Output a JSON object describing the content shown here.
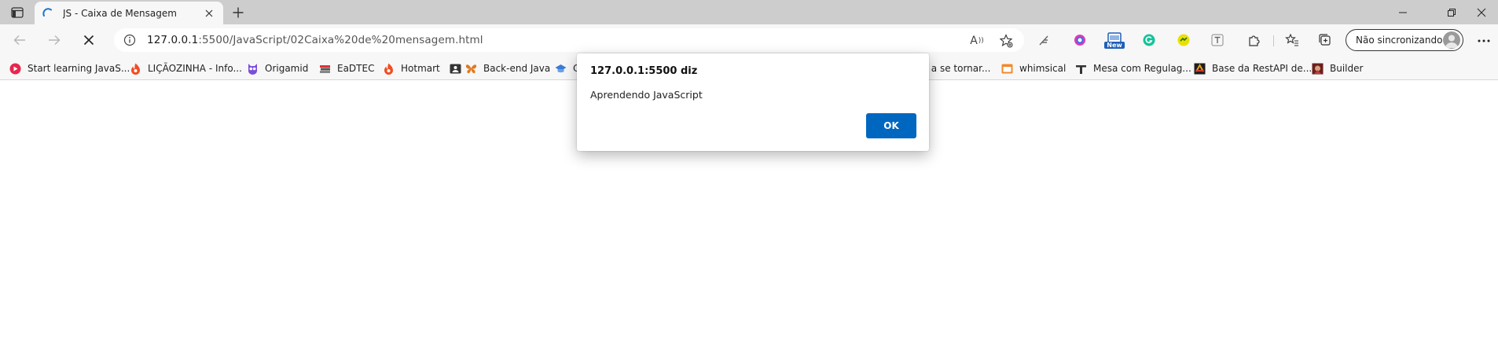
{
  "tab": {
    "title": "JS - Caixa de Mensagem"
  },
  "address_bar": {
    "host": "127.0.0.1",
    "rest": ":5500/JavaScript/02Caixa%20de%20mensagem.html"
  },
  "profile": {
    "label": "Não sincronizando"
  },
  "bookmarks": [
    {
      "label": "Start learning JavaS...",
      "icon": "red-circle-icon"
    },
    {
      "label": "LIÇÃOZINHA - Info...",
      "icon": "flame-icon"
    },
    {
      "label": "Origamid",
      "icon": "owl-icon"
    },
    {
      "label": "EaDTEC",
      "icon": "books-icon"
    },
    {
      "label": "Hotmart",
      "icon": "flame-icon"
    },
    {
      "label": "Back-end Java",
      "icon": "butterfly-icon"
    },
    {
      "label": "C",
      "icon": "cap-icon"
    },
    {
      "label": "da a se tornar...",
      "icon": ""
    },
    {
      "label": "whimsical",
      "icon": "whimsical-icon"
    },
    {
      "label": "Mesa com Regulag...",
      "icon": "tool-icon"
    },
    {
      "label": "Base da RestAPI de...",
      "icon": "tile-icon"
    },
    {
      "label": "Builder",
      "icon": "builder-icon"
    }
  ],
  "dialog": {
    "title": "127.0.0.1:5500 diz",
    "message": "Aprendendo JavaScript",
    "ok_label": "OK"
  },
  "extensions": {
    "new_badge": "New"
  },
  "colors": {
    "accent": "#0067c0",
    "tabstrip": "#cdcdcd",
    "toolbar": "#f7f7f7"
  }
}
